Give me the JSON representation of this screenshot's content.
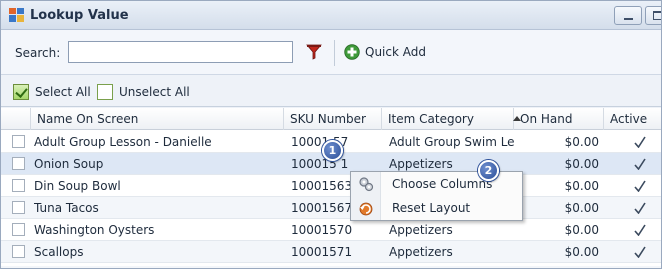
{
  "window": {
    "title": "Lookup Value"
  },
  "toolbar": {
    "search_label": "Search:",
    "search_value": "",
    "quick_add_label": "Quick Add"
  },
  "selection": {
    "select_all_label": "Select All",
    "unselect_all_label": "Unselect All"
  },
  "grid": {
    "columns": [
      "Name On Screen",
      "SKU Number",
      "Item Category",
      "On Hand",
      "Active"
    ],
    "sorted_column": "Item Category",
    "rows": [
      {
        "name": "Adult Group Lesson - Danielle",
        "sku": "10001 57",
        "category": "Adult Group Swim Le...",
        "on_hand": "$0.00",
        "active": true
      },
      {
        "name": "Onion Soup",
        "sku": "100015 1",
        "category": "Appetizers",
        "on_hand": "$0.00",
        "active": true
      },
      {
        "name": "Din Soup Bowl",
        "sku": "10001563",
        "category": "",
        "on_hand": "$0.00",
        "active": true
      },
      {
        "name": "Tuna Tacos",
        "sku": "10001567",
        "category": "",
        "on_hand": "$0.00",
        "active": true
      },
      {
        "name": "Washington  Oysters",
        "sku": "10001570",
        "category": "Appetizers",
        "on_hand": "$0.00",
        "active": true
      },
      {
        "name": "Scallops",
        "sku": "10001571",
        "category": "Appetizers",
        "on_hand": "$0.00",
        "active": true
      }
    ]
  },
  "context_menu": {
    "items": [
      {
        "label": "Choose Columns",
        "icon": "columns-gear-icon"
      },
      {
        "label": "Reset Layout",
        "icon": "reset-layout-icon"
      }
    ]
  },
  "callouts": [
    "1",
    "2"
  ],
  "colors": {
    "accent": "#2c4f98",
    "title_bar": "#d4deeb",
    "selected_row": "#dde7f5"
  }
}
